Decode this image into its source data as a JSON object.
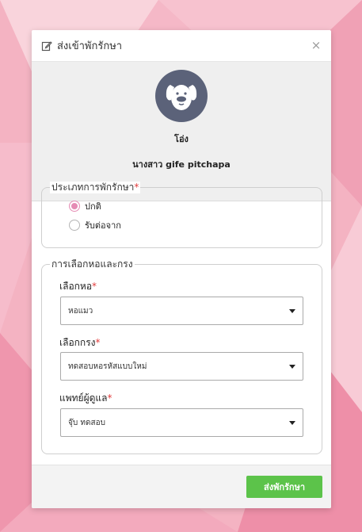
{
  "modal": {
    "title": "ส่งเข้าพักรักษา",
    "close_symbol": "×",
    "icons": {
      "title": "edit-icon",
      "close": "close-icon",
      "avatar": "dog-icon"
    }
  },
  "pet": {
    "name": "โอ่ง",
    "owner": "นางสาว gife pitchapa"
  },
  "admission_type": {
    "legend": "ประเภทการพักรักษา",
    "required_mark": "*",
    "options": [
      {
        "label": "ปกติ",
        "checked": true
      },
      {
        "label": "รับต่อจาก",
        "checked": false
      }
    ]
  },
  "ward_cage": {
    "legend": "การเลือกหอและกรง",
    "ward": {
      "label": "เลือกหอ",
      "required_mark": "*",
      "value": "หอแมว"
    },
    "cage": {
      "label": "เลือกกรง",
      "required_mark": "*",
      "value": "ทดสอบหอรหัสแบบใหม่"
    },
    "vet": {
      "label": "แพทย์ผู้ดูแล",
      "required_mark": "*",
      "value": "จุ๊บ ทดสอบ"
    }
  },
  "footer": {
    "submit_label": "ส่งพักรักษา"
  },
  "colors": {
    "accent_radio": "#e58bb4",
    "submit_button": "#5cc34a",
    "required": "#e23b3b",
    "avatar_bg": "#5b6279"
  }
}
